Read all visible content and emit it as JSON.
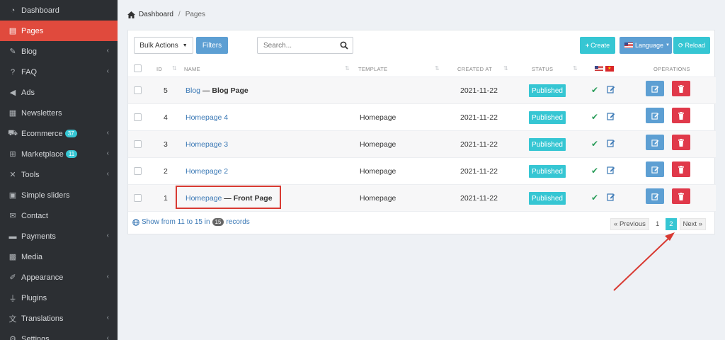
{
  "sidebar": {
    "items": [
      {
        "label": "Dashboard",
        "icon": "dashboard-icon",
        "badge": "",
        "arrow": false,
        "active": false
      },
      {
        "label": "Pages",
        "icon": "page-icon",
        "badge": "",
        "arrow": false,
        "active": true
      },
      {
        "label": "Blog",
        "icon": "blog-edit-icon",
        "badge": "",
        "arrow": true,
        "active": false
      },
      {
        "label": "FAQ",
        "icon": "question-circle-icon",
        "badge": "",
        "arrow": true,
        "active": false
      },
      {
        "label": "Ads",
        "icon": "bullhorn-icon",
        "badge": "",
        "arrow": false,
        "active": false
      },
      {
        "label": "Newsletters",
        "icon": "newspaper-icon",
        "badge": "",
        "arrow": false,
        "active": false
      },
      {
        "label": "Ecommerce",
        "icon": "cart-icon",
        "badge": "37",
        "arrow": true,
        "active": false
      },
      {
        "label": "Marketplace",
        "icon": "sitemap-icon",
        "badge": "11",
        "arrow": true,
        "active": false
      },
      {
        "label": "Tools",
        "icon": "tools-icon",
        "badge": "",
        "arrow": true,
        "active": false
      },
      {
        "label": "Simple sliders",
        "icon": "image-icon",
        "badge": "",
        "arrow": false,
        "active": false
      },
      {
        "label": "Contact",
        "icon": "envelope-icon",
        "badge": "",
        "arrow": false,
        "active": false
      },
      {
        "label": "Payments",
        "icon": "credit-card-icon",
        "badge": "",
        "arrow": true,
        "active": false
      },
      {
        "label": "Media",
        "icon": "media-icon",
        "badge": "",
        "arrow": false,
        "active": false
      },
      {
        "label": "Appearance",
        "icon": "paint-brush-icon",
        "badge": "",
        "arrow": true,
        "active": false
      },
      {
        "label": "Plugins",
        "icon": "plug-icon",
        "badge": "",
        "arrow": false,
        "active": false
      },
      {
        "label": "Translations",
        "icon": "language-icon",
        "badge": "",
        "arrow": true,
        "active": false
      },
      {
        "label": "Settings",
        "icon": "gear-icon",
        "badge": "",
        "arrow": true,
        "active": false
      }
    ]
  },
  "breadcrumb": {
    "home": "Dashboard",
    "current": "Pages"
  },
  "toolbar": {
    "bulk": "Bulk Actions",
    "filters": "Filters",
    "search_placeholder": "Search...",
    "create": "Create",
    "language": "Language",
    "reload": "Reload"
  },
  "table": {
    "headers": {
      "id": "ID",
      "name": "NAME",
      "template": "TEMPLATE",
      "created": "CREATED AT",
      "status": "STATUS",
      "operations": "OPERATIONS"
    },
    "rows": [
      {
        "id": "5",
        "name": "Blog",
        "suffix": "— Blog Page",
        "template": "",
        "created": "2021-11-22",
        "status": "Published"
      },
      {
        "id": "4",
        "name": "Homepage 4",
        "suffix": "",
        "template": "Homepage",
        "created": "2021-11-22",
        "status": "Published"
      },
      {
        "id": "3",
        "name": "Homepage 3",
        "suffix": "",
        "template": "Homepage",
        "created": "2021-11-22",
        "status": "Published"
      },
      {
        "id": "2",
        "name": "Homepage 2",
        "suffix": "",
        "template": "Homepage",
        "created": "2021-11-22",
        "status": "Published"
      },
      {
        "id": "1",
        "name": "Homepage",
        "suffix": "— Front Page",
        "template": "Homepage",
        "created": "2021-11-22",
        "status": "Published"
      }
    ]
  },
  "footer": {
    "show_from": "Show from 11 to 15 in",
    "total": "15",
    "records": "records"
  },
  "pager": {
    "prev": "« Previous",
    "p1": "1",
    "p2": "2",
    "next": "Next »"
  },
  "colors": {
    "accent": "#36c6d3",
    "sidebar_active": "#e04a3d",
    "delete": "#e0394a",
    "annotation": "#d83a32"
  }
}
